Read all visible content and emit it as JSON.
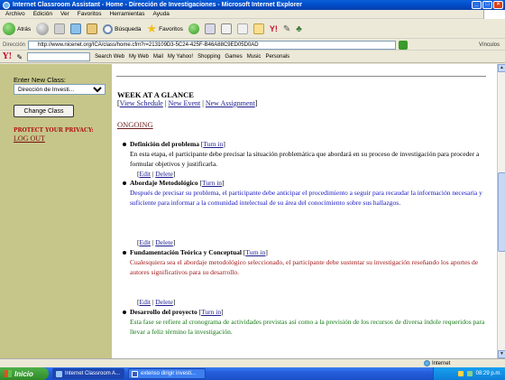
{
  "window": {
    "title": "Internet Classroom Assistant - Home - Dirección de Investigaciones - Microsoft Internet Explorer"
  },
  "menu": [
    "Archivo",
    "Edición",
    "Ver",
    "Favoritos",
    "Herramientas",
    "Ayuda"
  ],
  "toolbar": {
    "back_label": "Atrás",
    "search_label": "Búsqueda",
    "favorites_label": "Favoritos"
  },
  "address": {
    "label": "Dirección",
    "url": "http://www.nicenet.org/ICA/class/home.cfm?r=213109D3-5C24-425F-B46A88C9ED05D0AD",
    "links_label": "Vínculos"
  },
  "yahoo_bar": {
    "logo": "Y!",
    "search_web": "Search Web",
    "buttons": [
      "My Web",
      "Mail",
      "My Yahoo!",
      "Shopping",
      "Games",
      "Music",
      "Personals"
    ]
  },
  "sidebar": {
    "enter_class_label": "Enter New Class:",
    "class_select_value": "Dirección de Investi...",
    "change_class_button": "Change Class",
    "privacy_label": "PROTECT YOUR PRIVACY:",
    "logout_link": "LOG OUT"
  },
  "main": {
    "week_title": "WEEK AT A GLANCE",
    "links": {
      "open": "[",
      "view_schedule": "View Schedule",
      "sep1": " | ",
      "new_event": "New Event",
      "sep2": " | ",
      "new_assignment": "New Assignment",
      "close": "]"
    },
    "section": "ONGOING",
    "turn_in_label": "Turn in",
    "edit_label": "Edit",
    "delete_label": "Delete",
    "items": [
      {
        "title": "Definición del problema",
        "description": "En esta etapa, el participante debe precisar la situación problemática que abordará en su proceso de investigación para proceder a formular objetivos y justificarla."
      },
      {
        "title": "Abordaje Metodológico",
        "description": "Después de precisar su problema, el participante debe anticipar el procedimiento a seguir para recaudar la información necesaria y suficiente para informar a la comunidad intelectual de su área del conocimiento sobre sus hallazgos."
      },
      {
        "title": "Fundamentación Teórica y Conceptual",
        "description": "Cualesquiera sea el abordaje metodológico seleccionado, el participante debe sustentar su investigación reseñando los aportes de autores significativos para su desarrollo."
      },
      {
        "title": "Desarrollo del proyecto",
        "description": "Esta fase se refiere al cronograma de actividades previstas así como a la previsión de los recursos de diversa índole requeridos para llevar a feliz término la investigación."
      }
    ]
  },
  "status": {
    "zone": "Internet"
  },
  "taskbar": {
    "start": "Inicio",
    "tasks": [
      "Internet Classroom A...",
      "extenso dirigir investi..."
    ],
    "clock": "08:29 p.m."
  }
}
